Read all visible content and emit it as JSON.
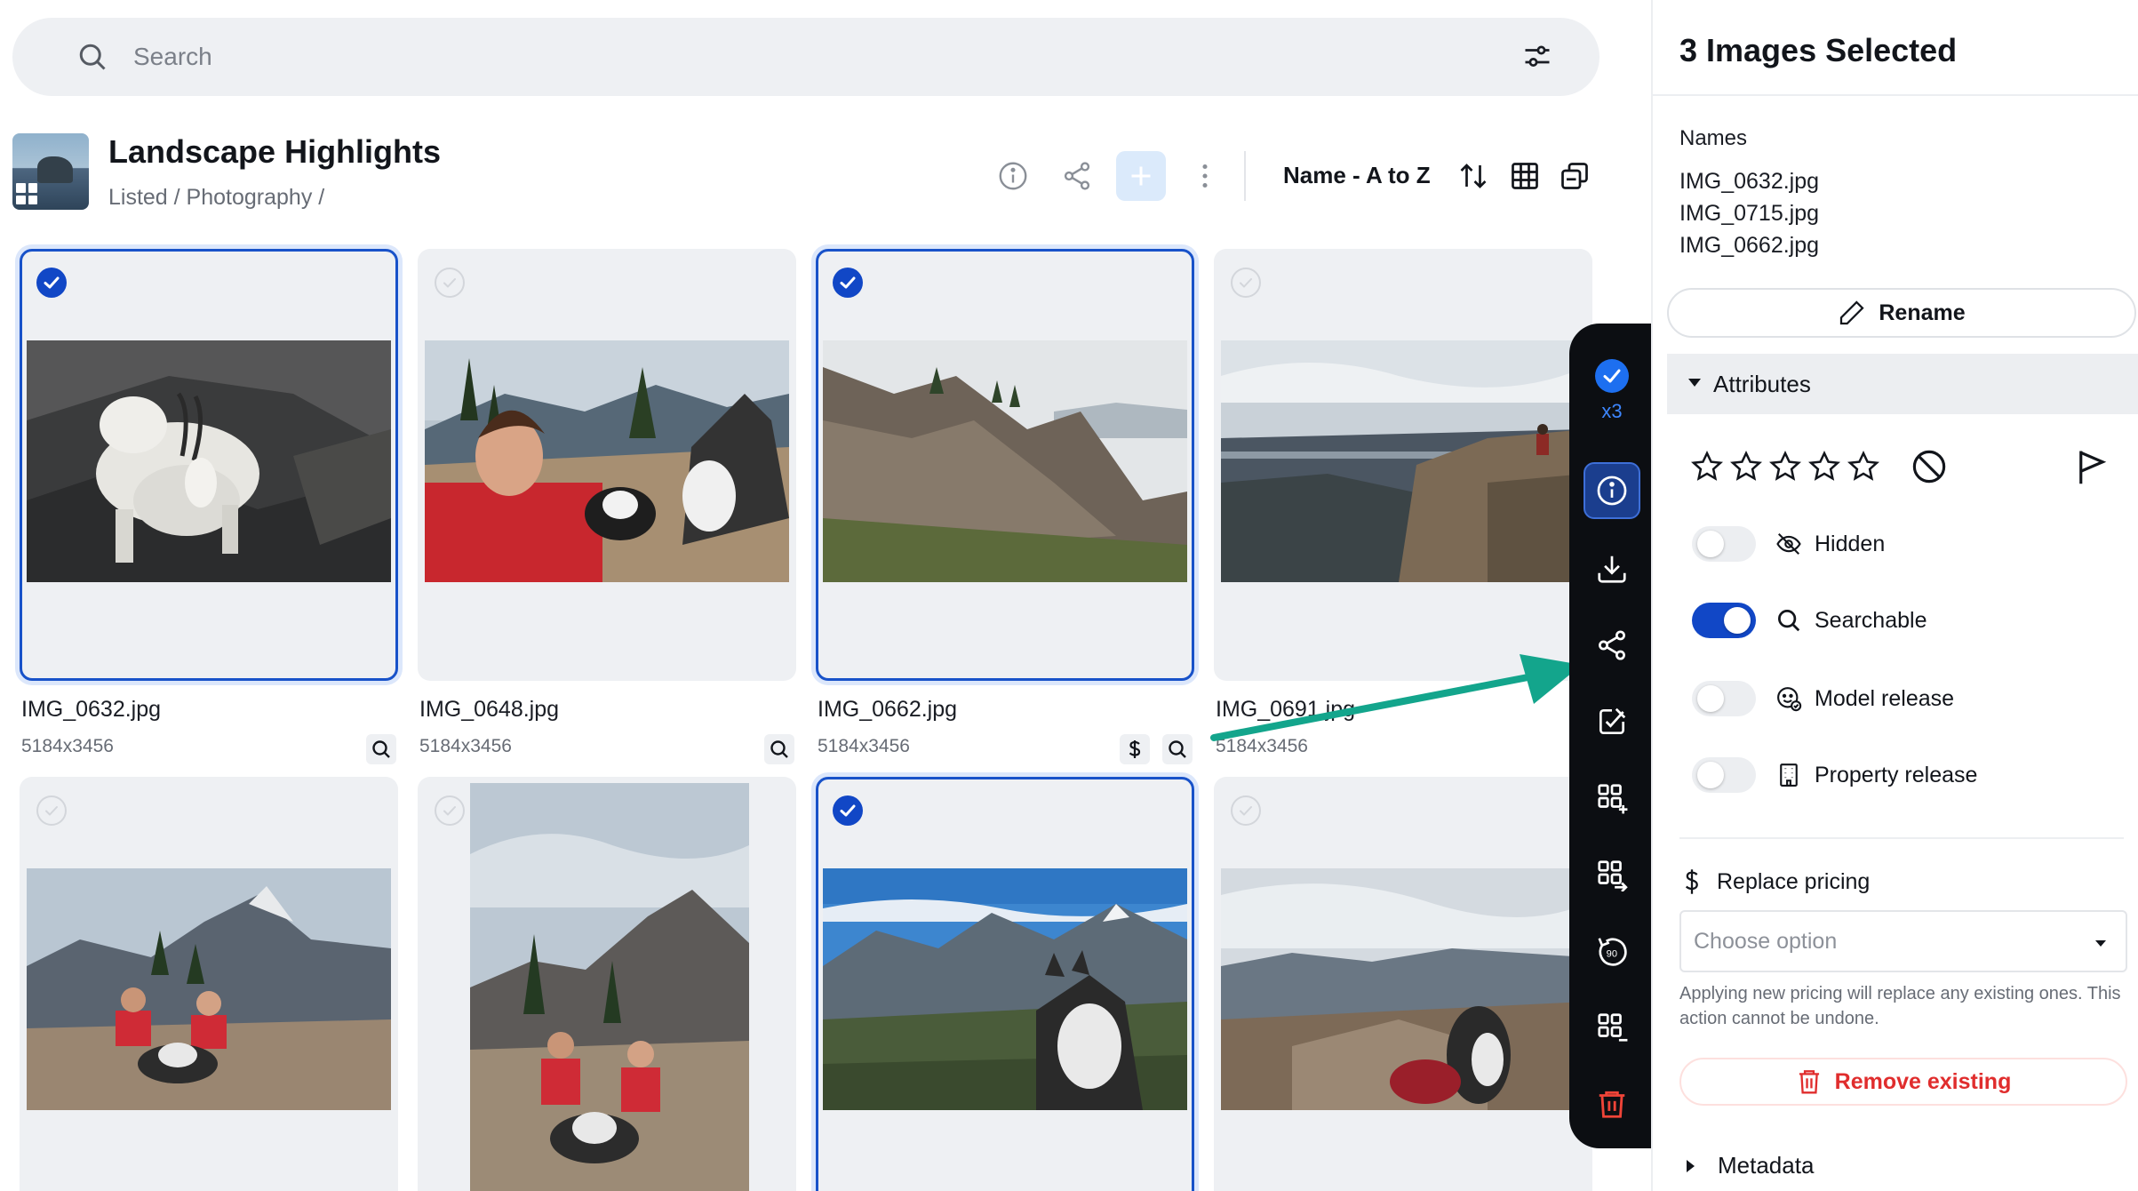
{
  "search": {
    "placeholder": "Search"
  },
  "album": {
    "title": "Landscape Highlights",
    "breadcrumb": "Listed / Photography /"
  },
  "toolbar": {
    "sort_label": "Name - A to Z"
  },
  "images": [
    {
      "name": "IMG_0632.jpg",
      "dims": "5184x3456",
      "selected": true
    },
    {
      "name": "IMG_0648.jpg",
      "dims": "5184x3456",
      "selected": false
    },
    {
      "name": "IMG_0662.jpg",
      "dims": "5184x3456",
      "selected": true
    },
    {
      "name": "IMG_0691.jpg",
      "dims": "5184x3456",
      "selected": false
    },
    {
      "selected": false
    },
    {
      "selected": false
    },
    {
      "selected": true
    },
    {
      "selected": false
    }
  ],
  "rail": {
    "count_label": "x3"
  },
  "panel": {
    "title": "3 Images Selected",
    "names_label": "Names",
    "names": [
      "IMG_0632.jpg",
      "IMG_0715.jpg",
      "IMG_0662.jpg"
    ],
    "rename_label": "Rename",
    "attributes_label": "Attributes",
    "toggles": [
      {
        "label": "Hidden",
        "on": false
      },
      {
        "label": "Searchable",
        "on": true
      },
      {
        "label": "Model release",
        "on": false
      },
      {
        "label": "Property release",
        "on": false
      }
    ],
    "pricing_label": "Replace pricing",
    "pricing_placeholder": "Choose option",
    "pricing_hint": "Applying new pricing will replace any existing ones. This action cannot be undone.",
    "remove_label": "Remove existing",
    "metadata_label": "Metadata"
  },
  "colors": {
    "accent": "#1147c6",
    "danger": "#e02d2d",
    "arrow": "#13a58c",
    "rail": "#0c0e12"
  }
}
